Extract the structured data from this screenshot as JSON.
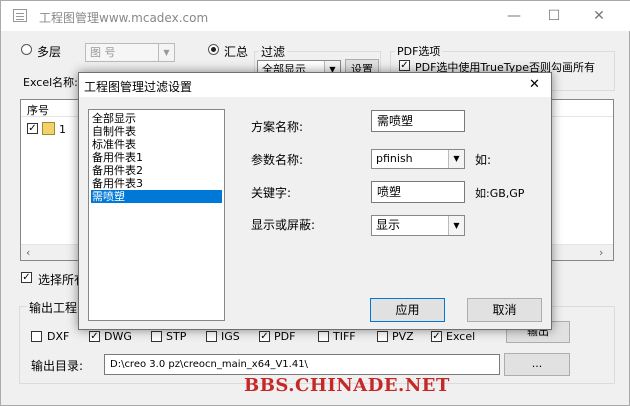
{
  "window": {
    "title": "工程图管理www.mcadex.com"
  },
  "toolbar": {
    "mode_multi": "多层",
    "layer_combo": "图 号",
    "mode_summary": "汇总",
    "filter_label": "过滤",
    "filter_combo": "全部显示",
    "settings_button": "设置",
    "excel_label": "Excel名称:",
    "pdf_group_label": "PDF选项",
    "pdf_truetype_option": "PDF选中使用TrueType否则勾画所有"
  },
  "table": {
    "columns": [
      "序号"
    ],
    "rows": [
      {
        "index": "1",
        "checked": true
      }
    ]
  },
  "select_all_label": "选择所有",
  "output": {
    "group_label": "输出工程",
    "formats": [
      {
        "label": "DXF",
        "checked": false
      },
      {
        "label": "DWG",
        "checked": true
      },
      {
        "label": "STP",
        "checked": false
      },
      {
        "label": "IGS",
        "checked": false
      },
      {
        "label": "PDF",
        "checked": true
      },
      {
        "label": "TIFF",
        "checked": false
      },
      {
        "label": "PVZ",
        "checked": false
      },
      {
        "label": "Excel",
        "checked": true
      }
    ],
    "export_button": "输出",
    "dir_label": "输出目录:",
    "dir_value": "D:\\creo 3.0 pz\\creocn_main_x64_V1.41\\",
    "browse_button": "..."
  },
  "dialog": {
    "title": "工程图管理过滤设置",
    "close": "✕",
    "schemes": [
      "全部显示",
      "自制件表",
      "标准件表",
      "备用件表1",
      "备用件表2",
      "备用件表3",
      "需喷塑"
    ],
    "selected_scheme": 6,
    "scheme_name_label": "方案名称:",
    "scheme_name_value": "需喷塑",
    "param_name_label": "参数名称:",
    "param_name_value": "pfinish",
    "param_example": "如:",
    "keyword_label": "关键字:",
    "keyword_value": "喷塑",
    "keyword_example": "如:GB,GP",
    "show_hide_label": "显示或屏蔽:",
    "show_hide_value": "显示",
    "apply_button": "应用",
    "cancel_button": "取消"
  },
  "watermark": "BBS.CHINADE.NET"
}
